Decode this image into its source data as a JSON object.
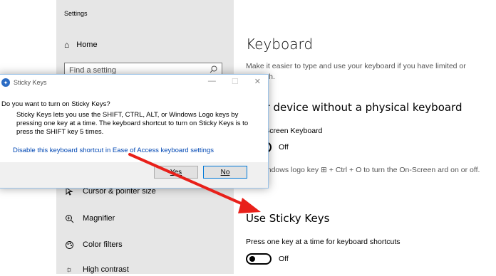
{
  "window": {
    "title": "Settings"
  },
  "sidebar": {
    "home_label": "Home",
    "search_placeholder": "Find a setting",
    "items": [
      {
        "label": "Cursor & pointer size",
        "icon": "cursor-icon"
      },
      {
        "label": "Magnifier",
        "icon": "magnifier-icon"
      },
      {
        "label": "Color filters",
        "icon": "color-filters-icon"
      },
      {
        "label": "High contrast",
        "icon": "brightness-icon"
      }
    ]
  },
  "main": {
    "title": "Keyboard",
    "description": "Make it easier to type and use your keyboard if you have limited or strength.",
    "section1_title": "your device without a physical keyboard",
    "onscreen_label": "e On-Screen Keyboard",
    "onscreen_state": "Off",
    "onscreen_desc": "the Windows logo key ⊞ + Ctrl + O to turn the On-Screen ard on or off.",
    "sticky_title": "Use Sticky Keys",
    "sticky_label": "Press one key at a time for keyboard shortcuts",
    "sticky_state": "Off"
  },
  "dialog": {
    "title": "Sticky Keys",
    "question": "Do you want to turn on Sticky Keys?",
    "body": "Sticky Keys lets you use the SHIFT, CTRL, ALT, or Windows Logo keys by pressing one key at a time. The keyboard shortcut to turn on Sticky Keys is to press the SHIFT key 5 times.",
    "link": "Disable this keyboard shortcut in Ease of Access keyboard settings",
    "yes_label": "Yes",
    "no_label": "No"
  },
  "colors": {
    "arrow": "#e8201a",
    "link": "#0047b3"
  }
}
